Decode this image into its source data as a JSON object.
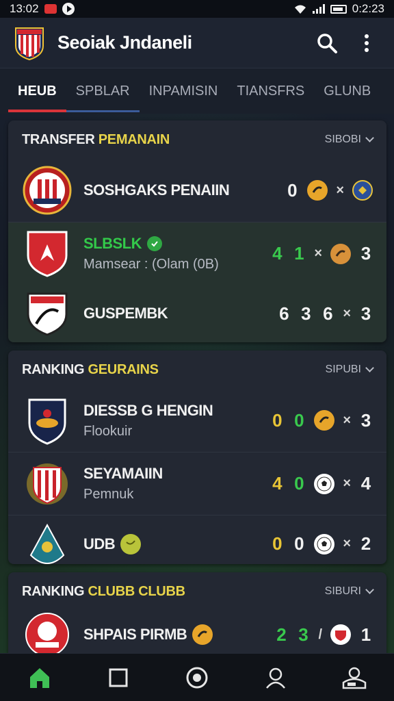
{
  "status_bar": {
    "time": "13:02",
    "battery_text": "0:2:23"
  },
  "app": {
    "title": "Seoiak Jndaneli"
  },
  "tabs": [
    {
      "label": "HEUB",
      "active": true
    },
    {
      "label": "SPBLAR"
    },
    {
      "label": "INPAMISIN"
    },
    {
      "label": "TIANSFRS"
    },
    {
      "label": "GLUNB"
    }
  ],
  "cards": [
    {
      "title_white": "TRANSFER ",
      "title_yellow": "PEMANAIN",
      "more_label": "SIBOBI",
      "rows": [
        {
          "team": "SOSHGAKS PENAIIN",
          "sub": "",
          "scores": [
            "0"
          ],
          "x_label": "×"
        },
        {
          "team": "SLBSLK",
          "sub": "Mamsear : (Olam (0B)",
          "scores": [
            "4",
            "1"
          ],
          "x_label": "×",
          "score_after": "3"
        },
        {
          "team": "GUSPEMBK",
          "sub": "",
          "scores": [
            "6",
            "3",
            "6"
          ],
          "x_label": "×",
          "score_after": "3"
        }
      ]
    },
    {
      "title_white": "RANKING ",
      "title_yellow": "GEURAINS",
      "more_label": "SIPUBI",
      "rows": [
        {
          "team": "DIESSB G HENGIN",
          "sub": "Flookuir",
          "scores": [
            "0",
            "0"
          ],
          "x_label": "×",
          "score_after": "3"
        },
        {
          "team": "SEYAMAIIN",
          "sub": "Pemnuk",
          "scores": [
            "4",
            "0"
          ],
          "x_label": "×",
          "score_after": "4"
        },
        {
          "team": "UDB",
          "sub": "",
          "scores": [
            "0",
            "0"
          ],
          "x_label": "×",
          "score_after": "2"
        }
      ]
    },
    {
      "title_white": "RANKING ",
      "title_yellow": "CLUBB CLUBB",
      "more_label": "SIBURI",
      "rows": [
        {
          "team": "SHPAIS PIRMB",
          "sub": "",
          "scores": [
            "2",
            "3"
          ],
          "x_label": "/",
          "score_after": "1"
        }
      ]
    }
  ],
  "bottom_nav": [
    {
      "icon": "home-icon",
      "active": true
    },
    {
      "icon": "square-icon"
    },
    {
      "icon": "record-icon"
    },
    {
      "icon": "profile-icon"
    },
    {
      "icon": "account-settings-icon"
    }
  ],
  "colors": {
    "accent_red": "#d8343a",
    "accent_yellow": "#e8d44a",
    "score_green": "#39c94d",
    "score_yellow": "#e8c536",
    "card_bg": "#232833"
  }
}
